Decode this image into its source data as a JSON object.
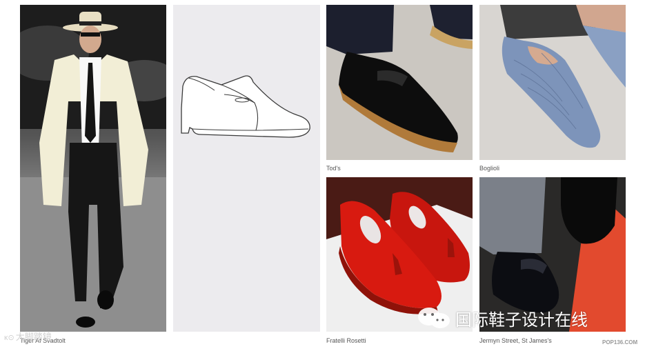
{
  "captions": {
    "look1": "Tiger Af Svadtolt",
    "look2": "Tod's",
    "look3": "Boglioli",
    "look4": "Fratelli Rosetti",
    "look5": "Jermyn Street, St James's"
  },
  "watermarks": {
    "left": "大脚踏镜",
    "right": "国际鞋子设计在线",
    "site": "POP136.COM"
  }
}
